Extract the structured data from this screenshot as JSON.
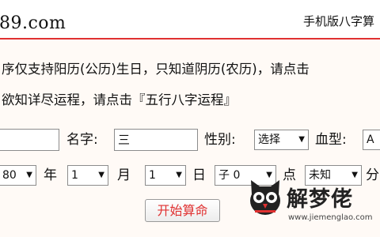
{
  "header": {
    "domain": "89.com",
    "mobile_link": "手机版八字算"
  },
  "notice": {
    "line1": "序仅支持阳历(公历)生日，只知道阴历(农历)，请点击",
    "line2": "欲知详尽运程，请点击『五行八字运程』"
  },
  "form": {
    "name_label": "名字:",
    "name_value": "三",
    "gender_label": "性别:",
    "gender_select": "选择",
    "blood_label": "血型:",
    "blood_select": "A",
    "year_select": "80",
    "year_label": "年",
    "month_select": "1",
    "month_label": "月",
    "day_select": "1",
    "day_label": "日",
    "hour_select": "子 0",
    "hour_label": "点",
    "minute_select": "未知",
    "minute_label": "分",
    "submit_label": "开始算命"
  },
  "watermark": {
    "brand": "解梦佬",
    "url": "www.jiemenglao.com"
  }
}
